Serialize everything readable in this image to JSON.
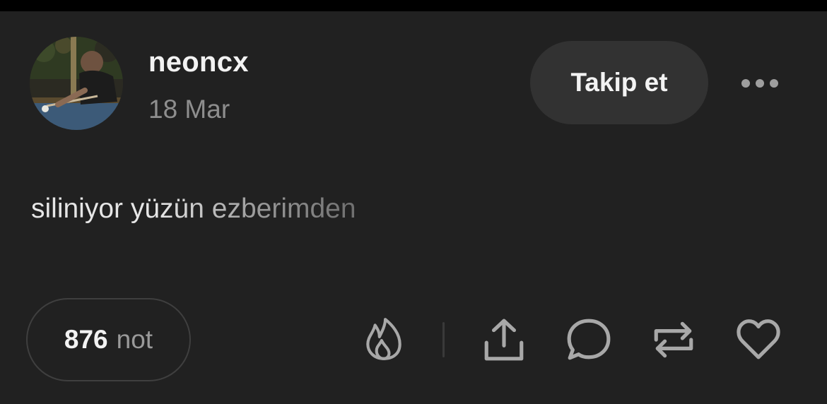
{
  "post": {
    "author": "neoncx",
    "date": "18 Mar",
    "follow_label": "Takip et",
    "text": "siliniyor yüzün ezberimden",
    "notes_count": "876",
    "notes_unit": "not"
  },
  "icons": {
    "more": "more-dots-icon",
    "blaze": "flame-icon",
    "share": "share-icon",
    "reply": "comment-icon",
    "reblog": "reblog-icon",
    "like": "heart-icon"
  },
  "colors": {
    "background": "#212121",
    "button": "#323232",
    "icon": "#a8a8a8"
  }
}
